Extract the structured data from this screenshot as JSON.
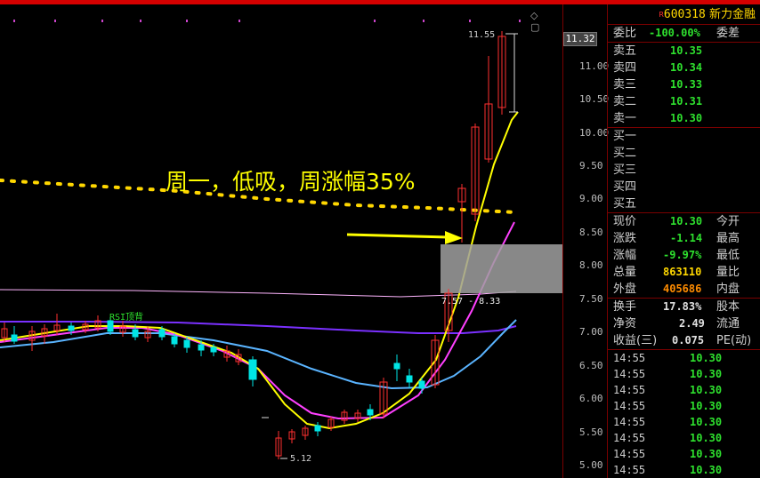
{
  "stock": {
    "code": "600318",
    "name": "新力金融",
    "tag": "R"
  },
  "chart": {
    "annotation": "周一，低吸，周涨幅35%",
    "high_label": "11.55",
    "low_label": "5.12",
    "box_label": "7.57 - 8.33",
    "rsi_label": "RSI顶背",
    "current_price_tag": "11.32",
    "controls": "◇ ▢",
    "y_ticks": [
      "11.00",
      "10.50",
      "10.00",
      "9.50",
      "9.00",
      "8.50",
      "8.00",
      "7.50",
      "7.00",
      "6.50",
      "6.00",
      "5.50",
      "5.00"
    ],
    "colors": {
      "up": "#ff3030",
      "down": "#00e5e5",
      "ma5": "#ffff00",
      "ma10": "#ff40ff",
      "ma20": "#5ab4ff",
      "ma60": "#7a30ff",
      "ma120": "#ffb6ff",
      "dotted": "#ffd700",
      "arrow": "#ffff00",
      "box": "#a0a0a0"
    }
  },
  "order_book": {
    "ratio": {
      "label": "委比",
      "value": "-100.00%",
      "label2": "委差"
    },
    "sells": [
      {
        "label": "卖五",
        "price": "10.35"
      },
      {
        "label": "卖四",
        "price": "10.34"
      },
      {
        "label": "卖三",
        "price": "10.33"
      },
      {
        "label": "卖二",
        "price": "10.31"
      },
      {
        "label": "卖一",
        "price": "10.30"
      }
    ],
    "buys": [
      {
        "label": "买一"
      },
      {
        "label": "买二"
      },
      {
        "label": "买三"
      },
      {
        "label": "买四"
      },
      {
        "label": "买五"
      }
    ]
  },
  "quote": [
    {
      "label": "现价",
      "value": "10.30",
      "label2": "今开",
      "color": "green"
    },
    {
      "label": "涨跌",
      "value": "-1.14",
      "label2": "最高",
      "color": "green"
    },
    {
      "label": "涨幅",
      "value": "-9.97%",
      "label2": "最低",
      "color": "green"
    },
    {
      "label": "总量",
      "value": "863110",
      "label2": "量比",
      "color": "yellow"
    },
    {
      "label": "外盘",
      "value": "405686",
      "label2": "内盘",
      "color": "orange"
    }
  ],
  "stats": [
    {
      "label": "换手",
      "value": "17.83%",
      "label2": "股本"
    },
    {
      "label": "净资",
      "value": "2.49",
      "label2": "流通"
    },
    {
      "label": "收益(三)",
      "value": "0.075",
      "label2": "PE(动)"
    }
  ],
  "ticks": [
    {
      "time": "14:55",
      "price": "10.30"
    },
    {
      "time": "14:55",
      "price": "10.30"
    },
    {
      "time": "14:55",
      "price": "10.30"
    },
    {
      "time": "14:55",
      "price": "10.30"
    },
    {
      "time": "14:55",
      "price": "10.30"
    },
    {
      "time": "14:55",
      "price": "10.30"
    },
    {
      "time": "14:55",
      "price": "10.30"
    },
    {
      "time": "14:55",
      "price": "10.30"
    }
  ]
}
